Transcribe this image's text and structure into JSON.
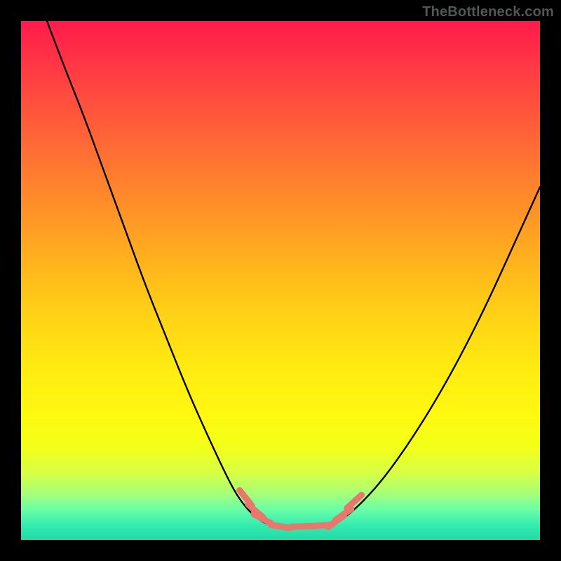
{
  "watermark": "TheBottleneck.com",
  "colors": {
    "frame": "#000000",
    "gradient_top": "#ff1a4b",
    "gradient_bottom": "#23d9a8",
    "curve": "#000000",
    "segment": "#e9776d"
  },
  "chart_data": {
    "type": "line",
    "title": "",
    "xlabel": "",
    "ylabel": "",
    "xlim": [
      0,
      100
    ],
    "ylim": [
      0,
      100
    ],
    "grid": false,
    "legend": false,
    "annotations": [
      "TheBottleneck.com"
    ],
    "note": "No axis ticks or numeric labels are rendered; values below are proportional positions estimated from the image (0–100 each axis, y=0 at bottom).",
    "series": [
      {
        "name": "left-curve",
        "x": [
          5,
          8,
          12,
          16,
          20,
          24,
          28,
          32,
          36,
          40,
          42,
          44,
          46,
          47.5
        ],
        "y": [
          100,
          92,
          82,
          71,
          60,
          49,
          39,
          29,
          20,
          11.5,
          8,
          5.5,
          3.8,
          3
        ]
      },
      {
        "name": "trough",
        "x": [
          47.5,
          50,
          53,
          56,
          59,
          60.5
        ],
        "y": [
          3,
          2.6,
          2.5,
          2.6,
          2.8,
          3
        ]
      },
      {
        "name": "right-curve",
        "x": [
          60.5,
          63,
          66,
          70,
          75,
          80,
          85,
          90,
          95,
          100
        ],
        "y": [
          3,
          4.8,
          7.5,
          12,
          19,
          27,
          36,
          46,
          57,
          68
        ]
      }
    ],
    "salmon_segments": {
      "note": "short coral-colored dash segments overlaid near the trough of the curve; (x,y) in same 0–100 space",
      "points": [
        {
          "x": 43.3,
          "y": 8.1
        },
        {
          "x": 45.2,
          "y": 5.6
        },
        {
          "x": 46.5,
          "y": 4.1
        },
        {
          "x": 50.0,
          "y": 2.6
        },
        {
          "x": 54.0,
          "y": 2.6
        },
        {
          "x": 58.0,
          "y": 2.8
        },
        {
          "x": 60.7,
          "y": 3.6
        },
        {
          "x": 62.1,
          "y": 4.9
        },
        {
          "x": 64.2,
          "y": 7.4
        }
      ]
    }
  }
}
